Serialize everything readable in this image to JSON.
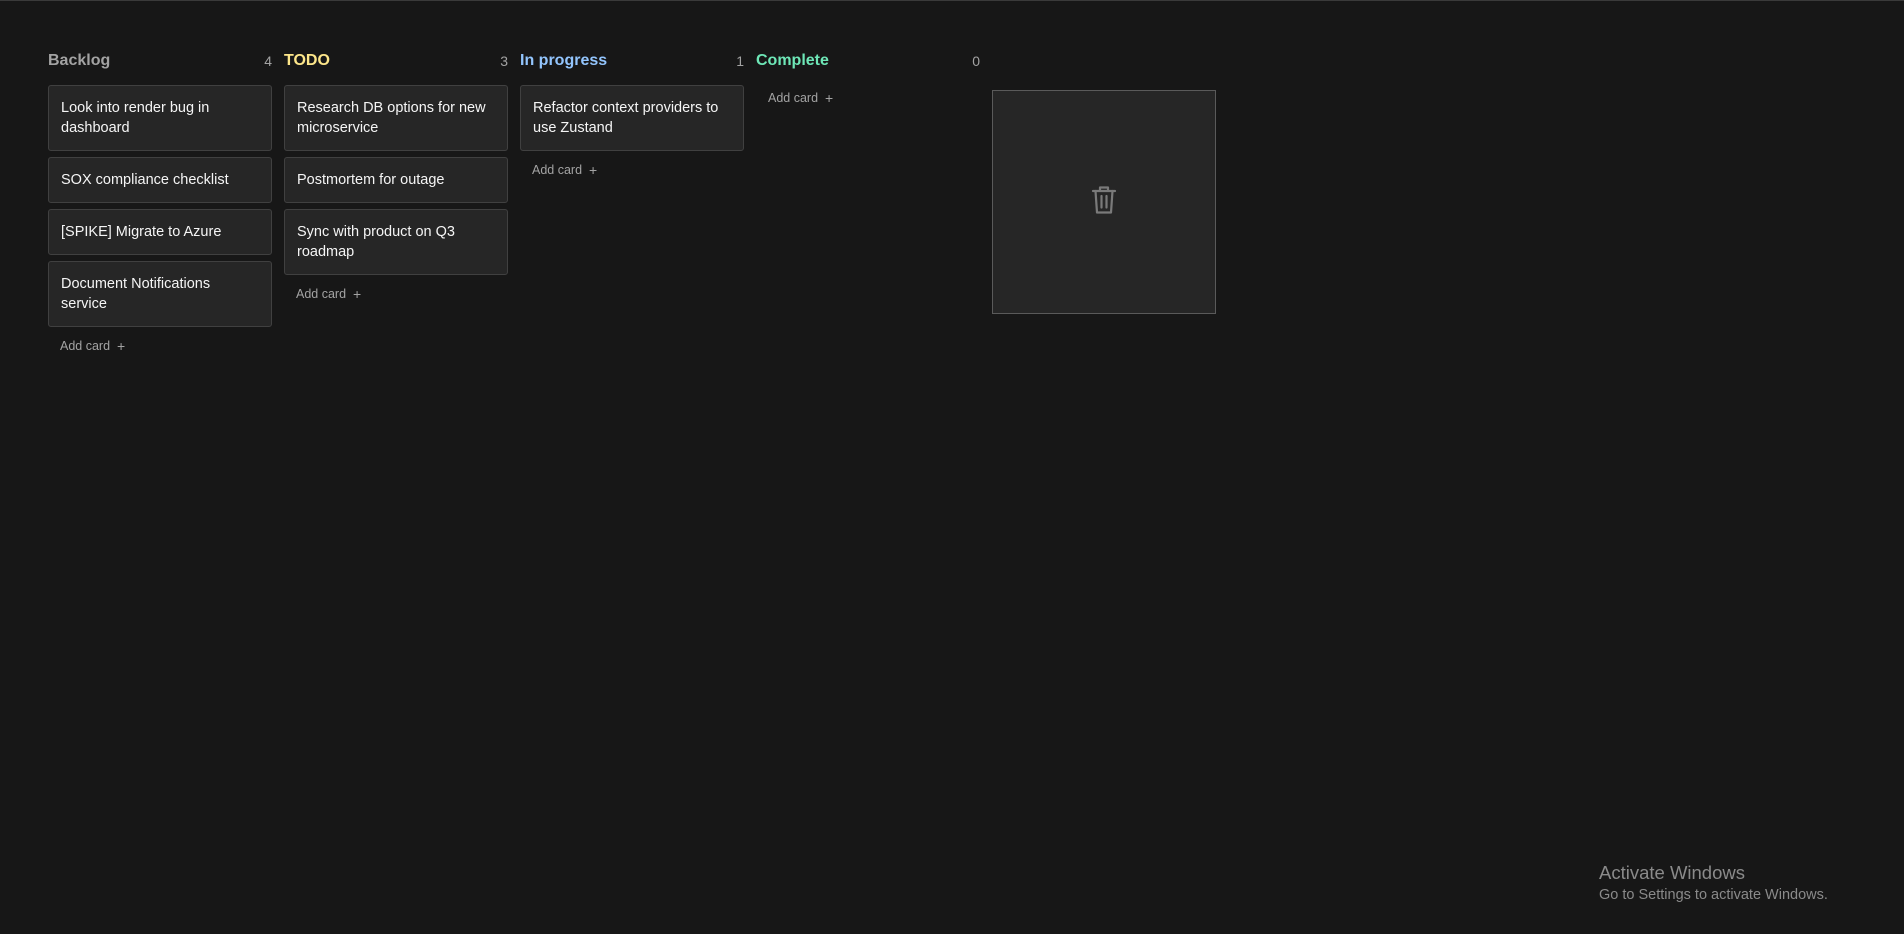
{
  "columns": [
    {
      "title": "Backlog",
      "count": "4",
      "title_color": "#a3a3a3",
      "cards": [
        "Look into render bug in dashboard",
        "SOX compliance checklist",
        "[SPIKE] Migrate to Azure",
        "Document Notifications service"
      ],
      "add_label": "Add card"
    },
    {
      "title": "TODO",
      "count": "3",
      "title_color": "#fde68a",
      "cards": [
        "Research DB options for new microservice",
        "Postmortem for outage",
        "Sync with product on Q3 roadmap"
      ],
      "add_label": "Add card"
    },
    {
      "title": "In progress",
      "count": "1",
      "title_color": "#93c5fd",
      "cards": [
        "Refactor context providers to use Zustand"
      ],
      "add_label": "Add card"
    },
    {
      "title": "Complete",
      "count": "0",
      "title_color": "#6ee7b7",
      "cards": [],
      "add_label": "Add card"
    }
  ],
  "trash": {
    "icon": "trash-icon"
  },
  "watermark": {
    "title": "Activate Windows",
    "subtitle": "Go to Settings to activate Windows."
  }
}
